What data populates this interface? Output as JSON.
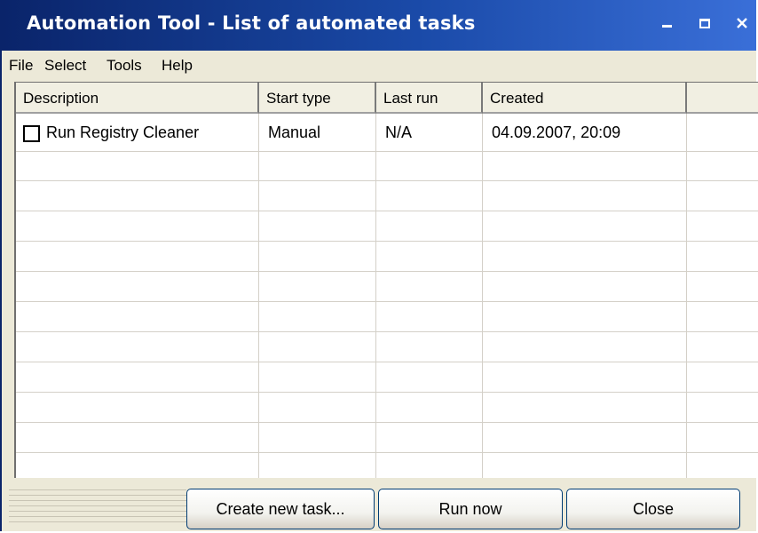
{
  "window": {
    "title": "Automation Tool - List of automated tasks"
  },
  "menu": {
    "items": [
      "File",
      "Select",
      "Tools",
      "Help"
    ]
  },
  "table": {
    "headers": [
      "Description",
      "Start type",
      "Last run",
      "Created",
      ""
    ],
    "rows": [
      {
        "checked": false,
        "description": "Run Registry Cleaner",
        "start_type": "Manual",
        "last_run": "N/A",
        "created": "04.09.2007, 20:09"
      }
    ]
  },
  "buttons": {
    "create": "Create new task...",
    "run": "Run now",
    "close": "Close"
  },
  "colors": {
    "titlebar_start": "#0a246a",
    "titlebar_end": "#3a6fd8",
    "window_bg": "#ece9d8",
    "button_border": "#003c74"
  },
  "icons": [
    "minimize-icon",
    "maximize-icon",
    "close-icon",
    "checkbox"
  ]
}
